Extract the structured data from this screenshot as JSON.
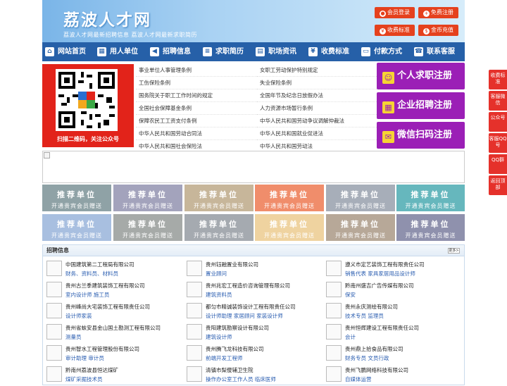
{
  "site": {
    "title": "荔波人才网",
    "slogan": "荔波人才网最新招聘信息  荔波人才网最新求职简历"
  },
  "header_buttons": [
    {
      "label": "会员登录",
      "icon": "user-icon"
    },
    {
      "label": "免费注册",
      "icon": "person-add-icon"
    },
    {
      "label": "收费标准",
      "icon": "yen-icon"
    },
    {
      "label": "金币充值",
      "icon": "coin-icon"
    }
  ],
  "nav": [
    {
      "label": "网站首页",
      "icon": "home-icon"
    },
    {
      "label": "用人单位",
      "icon": "building-icon"
    },
    {
      "label": "招聘信息",
      "icon": "megaphone-icon"
    },
    {
      "label": "求职简历",
      "icon": "resume-icon"
    },
    {
      "label": "职场资讯",
      "icon": "news-icon"
    },
    {
      "label": "收费标准",
      "icon": "yen-icon"
    },
    {
      "label": "付款方式",
      "icon": "card-icon"
    },
    {
      "label": "联系客服",
      "icon": "phone-icon"
    }
  ],
  "qr_caption": "扫描二维码，关注公众号",
  "laws": [
    [
      "事业单位人事管理条例",
      "女职工劳动保护特别规定"
    ],
    [
      "工伤保险条例",
      "失业保险条例"
    ],
    [
      "国务院关于职工工作时间的规定",
      "全国年节及纪念日放假办法"
    ],
    [
      "全国社会保障基金条例",
      "人力资源市场暂行条例"
    ],
    [
      "保障农民工工资支付条例",
      "中华人民共和国劳动争议调解仲裁法"
    ],
    [
      "中华人民共和国劳动合同法",
      "中华人民共和国就业促进法"
    ],
    [
      "中华人民共和国社会保险法",
      "中华人民共和国劳动法"
    ]
  ],
  "register": [
    {
      "label": "个人求职注册"
    },
    {
      "label": "企业招聘注册"
    },
    {
      "label": "微信扫码注册"
    }
  ],
  "tiles": {
    "title": "推荐单位",
    "subtitle": "开通贵宾会员赠送"
  },
  "tile_colors": [
    "#8fa2a6",
    "#a3a3bc",
    "#c7b69a",
    "#f08d6b",
    "#a7aeb9",
    "#66b7bd",
    "#a8bfe0",
    "#a6aaa8",
    "#a5aab0",
    "#efd3a0",
    "#b7a898",
    "#8f91ad"
  ],
  "jobs": {
    "title": "招聘信息",
    "more": "更多>",
    "companies": [
      {
        "name": "中国建筑第二工程局有限公司",
        "jobs": "财务、资料员、材料员"
      },
      {
        "name": "贵州钰融置业有限公司",
        "jobs": "置业顾问"
      },
      {
        "name": "遵义市定艺装饰工程有限责任公司",
        "jobs": "销售代表 家具家居用品设计师"
      },
      {
        "name": "贵州古兰季建筑装饰工程有限公司",
        "jobs": "室内设计师 施工员"
      },
      {
        "name": "贵州兆宏工程造价咨询管理有限公司",
        "jobs": "建筑资料员"
      },
      {
        "name": "黔南州盛吉广告传媒有限公司",
        "jobs": "保安"
      },
      {
        "name": "贵州峰尚大宅装饰工程有限责任公司",
        "jobs": "设计师家装"
      },
      {
        "name": "都匀市精诚装饰设计工程有限责任公司",
        "jobs": "设计师助理 家居顾问 家装设计师"
      },
      {
        "name": "贵州永庆测绘有限公司",
        "jobs": "技术专员 监理员"
      },
      {
        "name": "贵州省蚨安县金山国土勘测工程有限公司",
        "jobs": "测量员"
      },
      {
        "name": "贵阳建筑勘察设计有限公司",
        "jobs": "建筑设计师"
      },
      {
        "name": "贵州恒辉建设工程有限责任公司",
        "jobs": "会计"
      },
      {
        "name": "贵州智水工程管理股份有限公司",
        "jobs": "审计助理 审计员"
      },
      {
        "name": "贵州腾飞龙科技有限公司",
        "jobs": "前端开发工程师"
      },
      {
        "name": "贵州鼎上拾食品有限公司",
        "jobs": "财务专员 文员行政"
      },
      {
        "name": "黔南州荔波县恒达煤矿",
        "jobs": "煤矿采掘技术员"
      },
      {
        "name": "清镇市梨傻辅卫生院",
        "jobs": "操作办公室工作人员 临床医师"
      },
      {
        "name": "贵州飞鹏网络科技有限公司",
        "jobs": "自媒体运营"
      }
    ]
  },
  "sidebar": [
    {
      "label": "收费标准"
    },
    {
      "label": "客服微信"
    },
    {
      "label": "公众号"
    },
    {
      "label": "客服QQ号"
    },
    {
      "label": "QQ群"
    },
    {
      "label": "返回顶部"
    }
  ]
}
